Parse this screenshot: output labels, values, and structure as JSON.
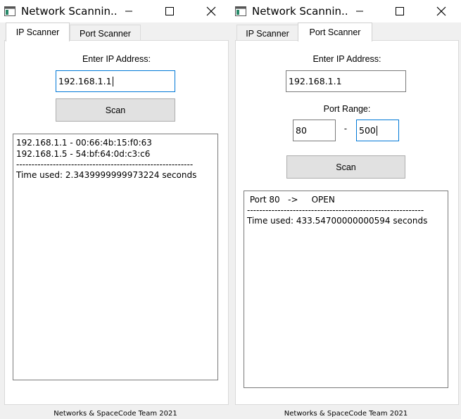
{
  "left_window": {
    "title": "Network Scannin...",
    "tabs": [
      "IP Scanner",
      "Port Scanner"
    ],
    "active_tab": "IP Scanner",
    "ip_label": "Enter IP Address:",
    "ip_value": "192.168.1.1",
    "scan_label": "Scan",
    "output": {
      "lines": [
        "192.168.1.1 - 00:66:4b:15:f0:63",
        "192.168.1.5 - 54:bf:64:0d:c3:c6"
      ],
      "separator": "----------------------------------------------------------",
      "time_line": "Time used: 2.3439999999973224 seconds"
    },
    "footer": "Networks & SpaceCode Team 2021"
  },
  "right_window": {
    "title": "Network Scannin...",
    "tabs": [
      "IP Scanner",
      "Port Scanner"
    ],
    "active_tab": "Port Scanner",
    "ip_label": "Enter IP Address:",
    "ip_value": "192.168.1.1",
    "port_range_label": "Port Range:",
    "port_from": "80",
    "port_dash": "-",
    "port_to": "500",
    "scan_label": "Scan",
    "output": {
      "result_line": " Port 80   ->     OPEN",
      "separator": "----------------------------------------------------------",
      "time_line": "Time used: 433.54700000000594 seconds"
    },
    "footer": "Networks & SpaceCode Team 2021"
  },
  "icons": {
    "app": "app-window-icon",
    "minimize": "minimize-icon",
    "maximize": "maximize-icon",
    "close": "close-icon"
  },
  "colors": {
    "focus_border": "#0078d7",
    "button_bg": "#e1e1e1",
    "window_bg": "#f0f0f0"
  }
}
